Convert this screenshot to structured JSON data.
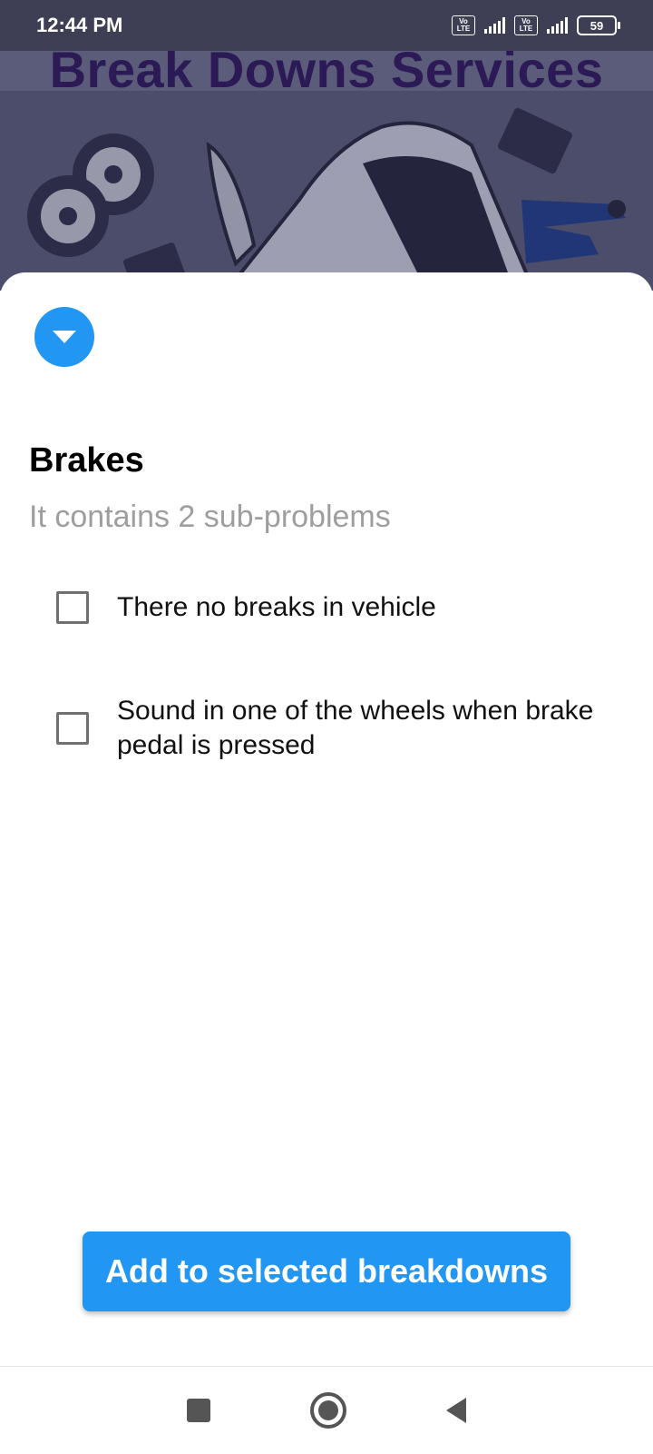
{
  "status_bar": {
    "time": "12:44 PM",
    "volte_1": "Vo LTE",
    "volte_2": "Vo LTE",
    "battery": "59"
  },
  "header": {
    "title": "Break Downs Services"
  },
  "sheet": {
    "category_title": "Brakes",
    "subtitle": "It contains 2 sub-problems",
    "problems": [
      {
        "label": "There no breaks in vehicle",
        "checked": false
      },
      {
        "label": "Sound in one of the wheels when brake pedal is pressed",
        "checked": false
      }
    ],
    "add_button_label": "Add to selected breakdowns"
  },
  "icons": {
    "expand": "chevron-down-icon",
    "nav_recents": "square-icon",
    "nav_home": "circle-icon",
    "nav_back": "triangle-back-icon"
  },
  "colors": {
    "accent": "#2196f3",
    "header_title": "#2b1a55",
    "subtitle": "#9e9e9e"
  }
}
